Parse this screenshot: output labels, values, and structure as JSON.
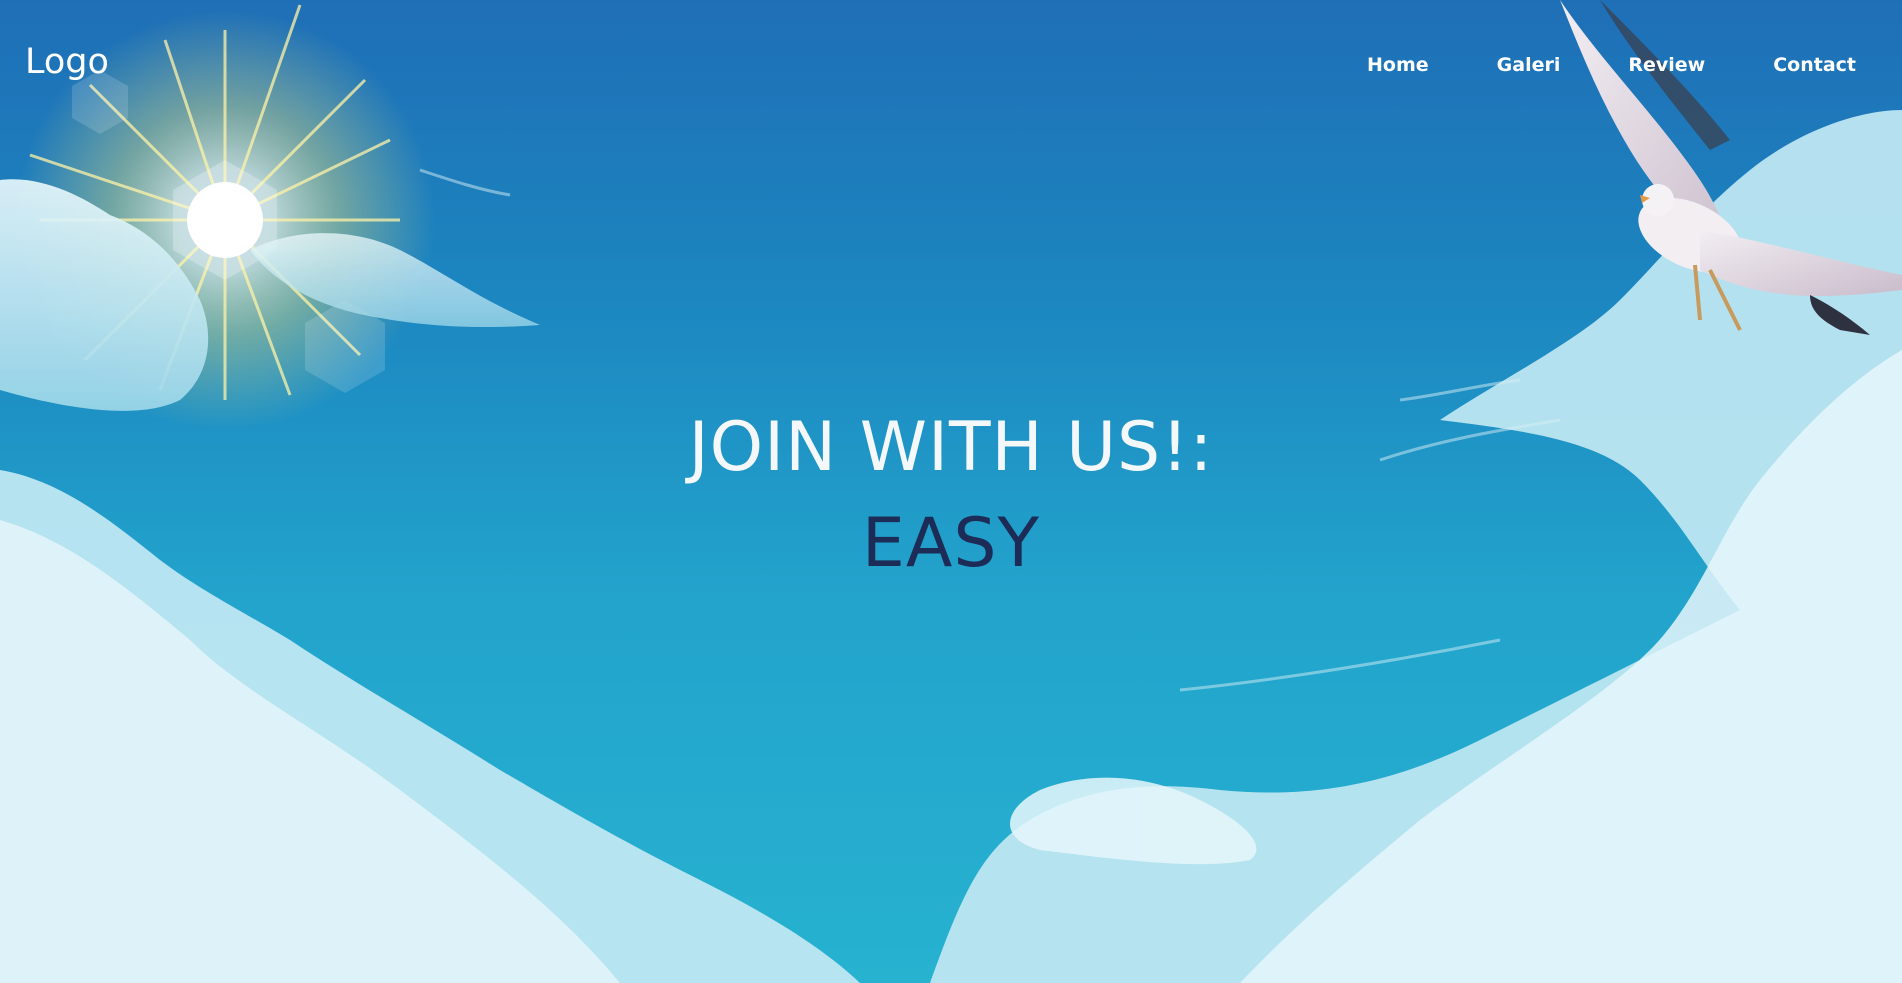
{
  "header": {
    "logo_text": "Logo",
    "nav": [
      {
        "label": "Home"
      },
      {
        "label": "Galeri"
      },
      {
        "label": "Review"
      },
      {
        "label": "Contact"
      }
    ]
  },
  "hero": {
    "title": "JOIN WITH US!:",
    "subtitle": "EASY"
  },
  "colors": {
    "text_light": "#ffffff",
    "subtitle": "#1c2c56",
    "sky_top": "#1f6fb6",
    "sky_bottom": "#27b2d0"
  }
}
